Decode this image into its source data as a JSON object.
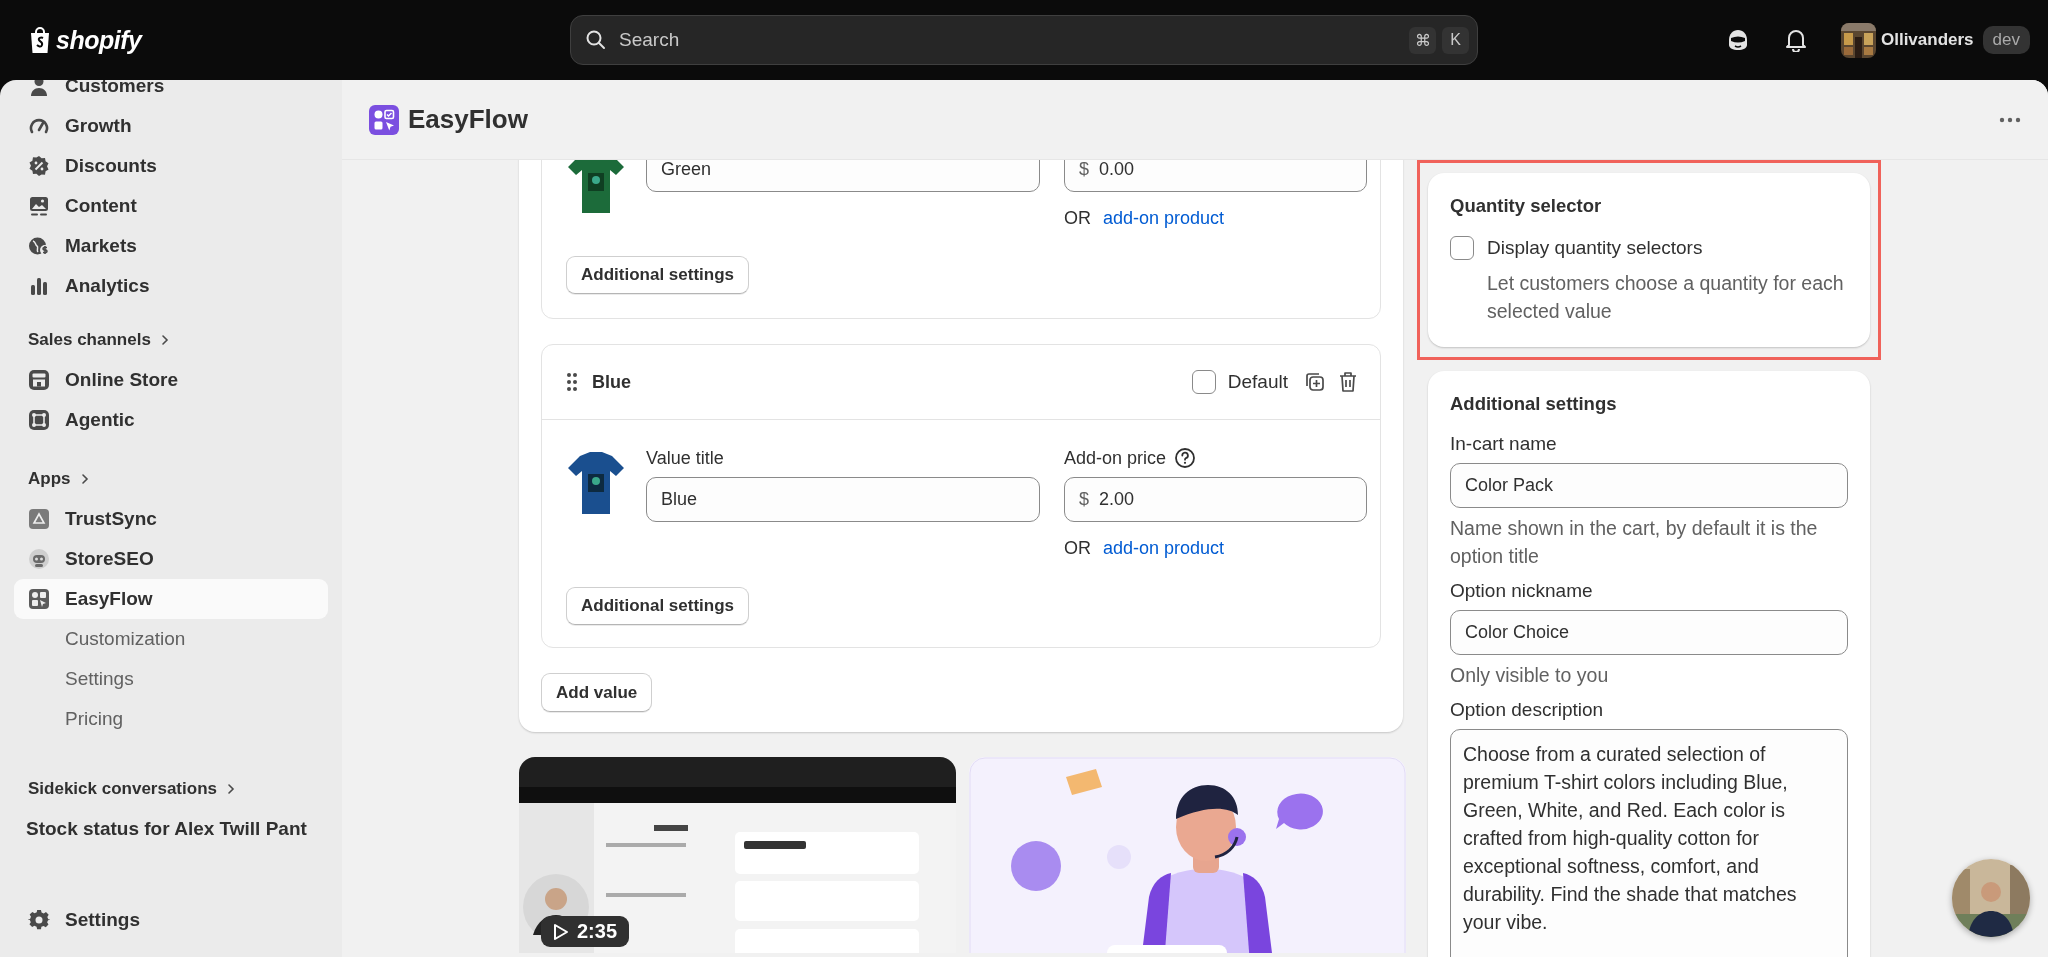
{
  "topbar": {
    "logo": "shopify",
    "search": {
      "placeholder": "Search",
      "keys": [
        "⌘",
        "K"
      ]
    },
    "store": {
      "name": "Ollivanders",
      "badge": "dev"
    }
  },
  "sidebar": {
    "items": [
      {
        "kind": "nav",
        "label": "Customers",
        "selected": false
      },
      {
        "kind": "nav",
        "label": "Growth",
        "selected": false
      },
      {
        "kind": "nav",
        "label": "Discounts",
        "selected": false
      },
      {
        "kind": "nav",
        "label": "Content",
        "selected": false
      },
      {
        "kind": "nav",
        "label": "Markets",
        "selected": false
      },
      {
        "kind": "nav",
        "label": "Analytics",
        "selected": false
      },
      {
        "kind": "heading",
        "label": "Sales channels",
        "selected": false
      },
      {
        "kind": "nav",
        "label": "Online Store",
        "selected": false
      },
      {
        "kind": "nav",
        "label": "Agentic",
        "selected": false
      },
      {
        "kind": "heading",
        "label": "Apps",
        "selected": false
      },
      {
        "kind": "nav",
        "label": "TrustSync",
        "selected": false
      },
      {
        "kind": "nav",
        "label": "StoreSEO",
        "selected": false
      },
      {
        "kind": "nav",
        "label": "EasyFlow",
        "selected": true
      },
      {
        "kind": "sub",
        "label": "Customization",
        "selected": false
      },
      {
        "kind": "sub",
        "label": "Settings",
        "selected": false
      },
      {
        "kind": "sub",
        "label": "Pricing",
        "selected": false
      },
      {
        "kind": "heading",
        "label": "Sidekick conversations",
        "selected": false
      },
      {
        "kind": "conversation",
        "label": "Stock status for Alex Twill Pant",
        "selected": false
      },
      {
        "kind": "footer",
        "label": "Settings",
        "selected": false
      }
    ]
  },
  "app_header": {
    "title": "EasyFlow"
  },
  "values": [
    {
      "value_title": "Green",
      "price_prefix": "$",
      "price": "0.00",
      "or": "OR",
      "addon_link": "add-on product",
      "settings_button": "Additional settings"
    },
    {
      "name": "Blue",
      "default_label": "Default",
      "default_checked": false,
      "value_title_label": "Value title",
      "value_title": "Blue",
      "price_label": "Add-on price",
      "price_prefix": "$",
      "price": "2.00",
      "or": "OR",
      "addon_link": "add-on product",
      "settings_button": "Additional settings"
    }
  ],
  "add_value_button": "Add value",
  "media": [
    {
      "kind": "video",
      "duration": "2:35"
    },
    {
      "kind": "picture"
    }
  ],
  "quantity_card": {
    "highlighted": true,
    "title": "Quantity selector",
    "checkbox": {
      "label": "Display quantity selectors",
      "checked": false
    },
    "help": "Let customers choose a quantity for each selected value"
  },
  "additional_settings": {
    "title": "Additional settings",
    "fields": [
      {
        "kind": "input",
        "label": "In-cart name",
        "value": "Color Pack",
        "help": "Name shown in the cart, by default it is the option title"
      },
      {
        "kind": "input",
        "label": "Option nickname",
        "value": "Color Choice",
        "help": "Only visible to you"
      },
      {
        "kind": "textarea",
        "label": "Option description",
        "value": "Choose from a curated selection of premium T-shirt colors including Blue, Green, White, and Red. Each color is crafted from high-quality cotton for exceptional softness, comfort, and durability. Find the shade that matches your vibe."
      }
    ]
  }
}
